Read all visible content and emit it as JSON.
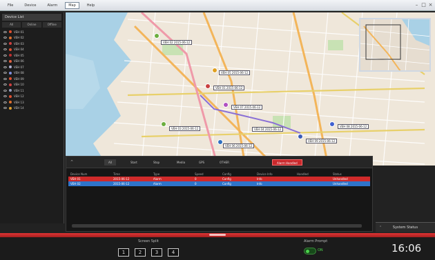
{
  "titlebar": {
    "items": [
      {
        "label": "File"
      },
      {
        "label": "Device"
      },
      {
        "label": "Alarm"
      },
      {
        "label": "Map"
      },
      {
        "label": "Help"
      }
    ],
    "active_index": 3
  },
  "left_panel": {
    "title": "Device List",
    "tabs": [
      "All",
      "Online",
      "Offline"
    ],
    "devices": [
      {
        "label": "VEH 01",
        "color": "#e05030"
      },
      {
        "label": "VEH 02",
        "color": "#e07030"
      },
      {
        "label": "VEH 03",
        "color": "#d04040"
      },
      {
        "label": "VEH 04",
        "color": "#e05030"
      },
      {
        "label": "VEH 05",
        "color": "#c03030"
      },
      {
        "label": "VEH 06",
        "color": "#e06040"
      },
      {
        "label": "VEH 07",
        "color": "#b0b0d0"
      },
      {
        "label": "VEH 08",
        "color": "#8090e0"
      },
      {
        "label": "VEH 09",
        "color": "#e05030"
      },
      {
        "label": "VEH 10",
        "color": "#d04040"
      },
      {
        "label": "VEH 11",
        "color": "#9aa0c0"
      },
      {
        "label": "VEH 12",
        "color": "#e05030"
      },
      {
        "label": "VEH 13",
        "color": "#e07030"
      },
      {
        "label": "VEH 14",
        "color": "#e0a030"
      }
    ]
  },
  "map": {
    "labels": [
      "VEH 02  2015-06-12",
      "VEH 05  2015-06-12",
      "VEH 01  2015-06-12",
      "VEH 07  2015-06-12",
      "VEH 03  2015-06-12",
      "VEH 08  2015-06-12",
      "VEH 06  2015-06-12",
      "VEH 04  2015-06-12",
      "VEH 09  2015-06-12"
    ],
    "marker_colors": [
      "#6cae3e",
      "#e0a020",
      "#c84040",
      "#b050c0",
      "#6cae3e",
      "#4060d0",
      "#3070c0",
      "#3c5cb8"
    ]
  },
  "alarm_panel": {
    "collapse_icon": "chevron-up-icon",
    "tabs": [
      {
        "label": "All"
      },
      {
        "label": "Start"
      },
      {
        "label": "Stop"
      },
      {
        "label": "Media"
      },
      {
        "label": "GPS"
      },
      {
        "label": "OTHER"
      },
      {
        "label": "Alarm Handled"
      }
    ],
    "selected_tab": 0,
    "alarm_tab": 6,
    "columns": [
      "Device Num",
      "Time",
      "Type",
      "Speed",
      "Config",
      "Device Info",
      "Handled",
      "Status"
    ],
    "rows": [
      {
        "style": "red",
        "cells": [
          "VEH 01",
          "2015-06-12",
          "Alarm",
          "0",
          "Config",
          "Info",
          "",
          "Unhandled"
        ]
      },
      {
        "style": "blue",
        "cells": [
          "VEH 02",
          "2015-06-12",
          "Alarm",
          "0",
          "Config",
          "Info",
          "",
          "Unhandled"
        ]
      }
    ]
  },
  "system_status": {
    "label": "System Status"
  },
  "bottom": {
    "screen_split_label": "Screen Split",
    "split_buttons": [
      "1",
      "2",
      "3",
      "4"
    ],
    "alarm_prompt_label": "Alarm Prompt",
    "alarm_prompt_state": "ON",
    "clock": "16:06"
  },
  "colors": {
    "accent_red": "#d02a2a",
    "row_blue": "#2f74c9",
    "toggle_green": "#4cd34c"
  }
}
